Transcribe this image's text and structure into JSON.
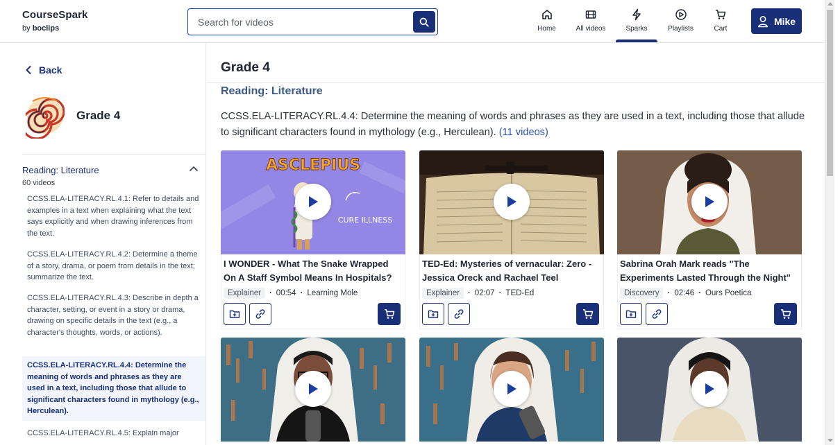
{
  "header": {
    "logo_title": "CourseSpark",
    "logo_by": "by",
    "logo_brand": "boclips",
    "search_placeholder": "Search for videos",
    "nav": [
      {
        "label": "Home",
        "icon": "home-icon"
      },
      {
        "label": "All videos",
        "icon": "film-icon"
      },
      {
        "label": "Sparks",
        "icon": "lightning-icon",
        "active": true
      },
      {
        "label": "Playlists",
        "icon": "playlist-play-icon"
      },
      {
        "label": "Cart",
        "icon": "cart-icon"
      }
    ],
    "user_label": "Mike"
  },
  "sidebar": {
    "back_label": "Back",
    "grade_name": "Grade 4",
    "section_title": "Reading: Literature",
    "section_count": "60 videos",
    "standards": [
      "CCSS.ELA-LITERACY.RL.4.1: Refer to details and examples in a text when explaining what the text says explicitly and when drawing inferences from the text.",
      "CCSS.ELA-LITERACY.RL.4.2: Determine a theme of a story, drama, or poem from details in the text; summarize the text.",
      "CCSS.ELA-LITERACY.RL.4.3: Describe in depth a character, setting, or event in a story or drama, drawing on specific details in the text (e.g., a character's thoughts, words, or actions).",
      "CCSS.ELA-LITERACY.RL.4.4: Determine the meaning of words and phrases as they are used in a text, including those that allude to significant characters found in mythology (e.g., Herculean).",
      "CCSS.ELA-LITERACY.RL.4.5: Explain major"
    ],
    "active_index": 3
  },
  "main": {
    "title": "Grade 4",
    "subtitle": "Reading: Literature",
    "description": "CCSS.ELA-LITERACY.RL.4.4: Determine the meaning of words and phrases as they are used in a text, including those that allude to significant characters found in mythology (e.g., Herculean).",
    "count_label": "(11 videos)",
    "cards": [
      {
        "title": "I WONDER - What The Snake Wrapped On A Staff Symbol Means In Hospitals?",
        "type": "Explainer",
        "duration": "00:54",
        "channel": "Learning Mole",
        "thumb_text": "ASCLEPIUS",
        "thumb_caption": "CURE ILLNESS"
      },
      {
        "title": "TED-Ed: Mysteries of vernacular: Zero - Jessica Oreck and Rachael Teel",
        "type": "Explainer",
        "duration": "02:07",
        "channel": "TED-Ed"
      },
      {
        "title": "Sabrina Orah Mark reads \"The Experiments Lasted Through the Night\"",
        "type": "Discovery",
        "duration": "02:46",
        "channel": "Ours Poetica"
      }
    ],
    "colors": {
      "primary": "#193078",
      "link": "#2b52b8",
      "subtitle": "#3b5a8a"
    }
  }
}
